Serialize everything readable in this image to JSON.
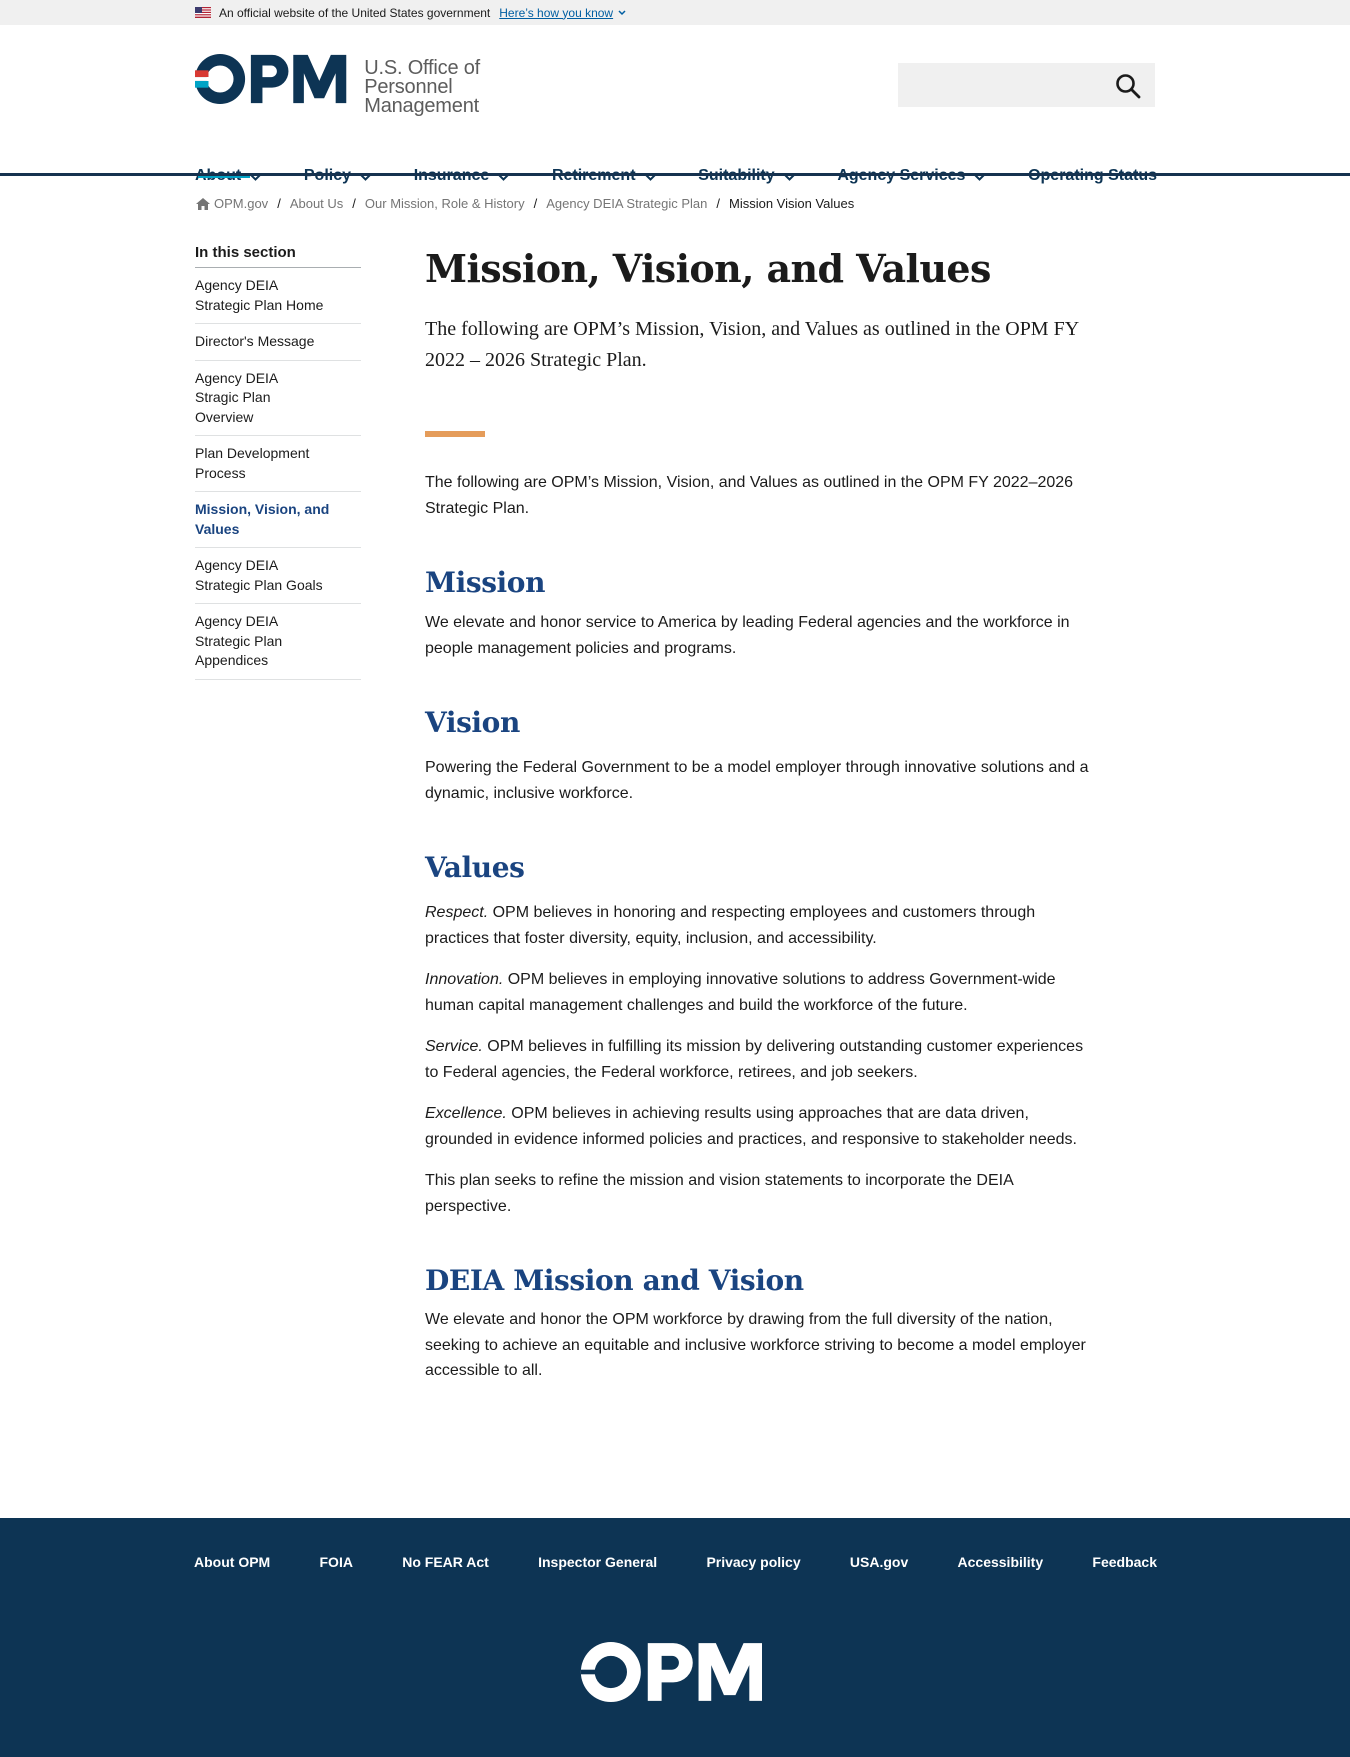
{
  "gov_banner": {
    "text": "An official website of the United States government",
    "link": "Here’s how you know"
  },
  "header": {
    "logo_text": "OPM",
    "agency_line1": "U.S. Office of",
    "agency_line2": "Personnel Management",
    "search": {
      "placeholder": "",
      "value": ""
    }
  },
  "nav": {
    "items": [
      {
        "label": "About",
        "dropdown": true,
        "active": true
      },
      {
        "label": "Policy",
        "dropdown": true
      },
      {
        "label": "Insurance",
        "dropdown": true
      },
      {
        "label": "Retirement",
        "dropdown": true
      },
      {
        "label": "Suitability",
        "dropdown": true
      },
      {
        "label": "Agency Services",
        "dropdown": true
      },
      {
        "label": "Operating Status",
        "dropdown": false
      }
    ]
  },
  "breadcrumb": {
    "items": [
      "OPM.gov",
      "About Us",
      "Our Mission, Role & History",
      "Agency DEIA Strategic Plan",
      "Mission Vision Values"
    ],
    "separator": "/"
  },
  "sidebar": {
    "title": "In this section",
    "items": [
      {
        "lines": [
          "Agency DEIA",
          "Strategic Plan Home"
        ]
      },
      {
        "lines": [
          "Director's Message"
        ]
      },
      {
        "lines": [
          "Agency DEIA",
          "Stragic Plan",
          "Overview"
        ]
      },
      {
        "lines": [
          "Plan Development",
          "Process"
        ]
      },
      {
        "lines": [
          "Mission, Vision, and",
          "Values"
        ],
        "active": true
      },
      {
        "lines": [
          "Agency DEIA",
          "Strategic Plan Goals"
        ]
      },
      {
        "lines": [
          "Agency DEIA",
          "Strategic Plan",
          "Appendices"
        ]
      }
    ]
  },
  "main": {
    "title": "Mission, Vision, and Values",
    "lead_line1": "The following are OPM’s Mission, Vision, and Values as outlined in the OPM FY",
    "lead_line2": "2022 – 2026 Strategic Plan.",
    "intro_line1": "The following are OPM’s Mission, Vision, and Values as outlined in the OPM FY 2022–2026",
    "intro_line2": "Strategic Plan.",
    "mission_heading": "Mission",
    "mission_line1": "We elevate and honor service to America by leading Federal agencies and the workforce in",
    "mission_line2": "people management policies and programs.",
    "vision_heading": "Vision",
    "vision_line1": "Powering the Federal Government to be a model employer through innovative solutions and a",
    "vision_line2": "dynamic, inclusive workforce.",
    "values_heading": "Values",
    "values": [
      {
        "term": "Respect.",
        "line1": " OPM believes in honoring and respecting employees and customers through",
        "line2": "practices that foster diversity, equity, inclusion, and accessibility."
      },
      {
        "term": "Innovation.",
        "line1": " OPM believes in employing innovative solutions to address Government-wide",
        "line2": "human capital management challenges and build the workforce of the future."
      },
      {
        "term": "Service.",
        "line1": " OPM believes in fulfilling its mission by delivering outstanding customer experiences",
        "line2": "to Federal agencies, the Federal workforce, retirees, and job seekers."
      },
      {
        "term": "Excellence.",
        "line1": " OPM believes in achieving results using approaches that are data driven,",
        "line2": "grounded in evidence informed policies and practices, and responsive to stakeholder needs."
      }
    ],
    "refine_line1": "This plan seeks to refine the mission and vision statements to incorporate the DEIA",
    "refine_line2": "perspective.",
    "deia_heading": "DEIA Mission and Vision",
    "deia_line1": "We elevate and honor the OPM workforce by drawing from the full diversity of the nation,",
    "deia_line2": "seeking to achieve an equitable and inclusive workforce striving to become a model employer",
    "deia_line3": "accessible to all."
  },
  "footer": {
    "links": [
      "About OPM",
      "FOIA",
      "No FEAR Act",
      "Inspector General",
      "Privacy policy",
      "USA.gov",
      "Accessibility",
      "Feedback"
    ],
    "logo_text": "OPM"
  },
  "colors": {
    "navy": "#0d3454",
    "heading_blue": "#1a4480",
    "nav_active": "#00a3c6",
    "accent_orange": "#e59c5a",
    "logo_red": "#d83933",
    "logo_blue": "#00a3c6"
  },
  "icons": {
    "flag": "us-flag-icon",
    "search": "search-icon",
    "home": "home-icon",
    "chevron": "chevron-down-icon"
  }
}
